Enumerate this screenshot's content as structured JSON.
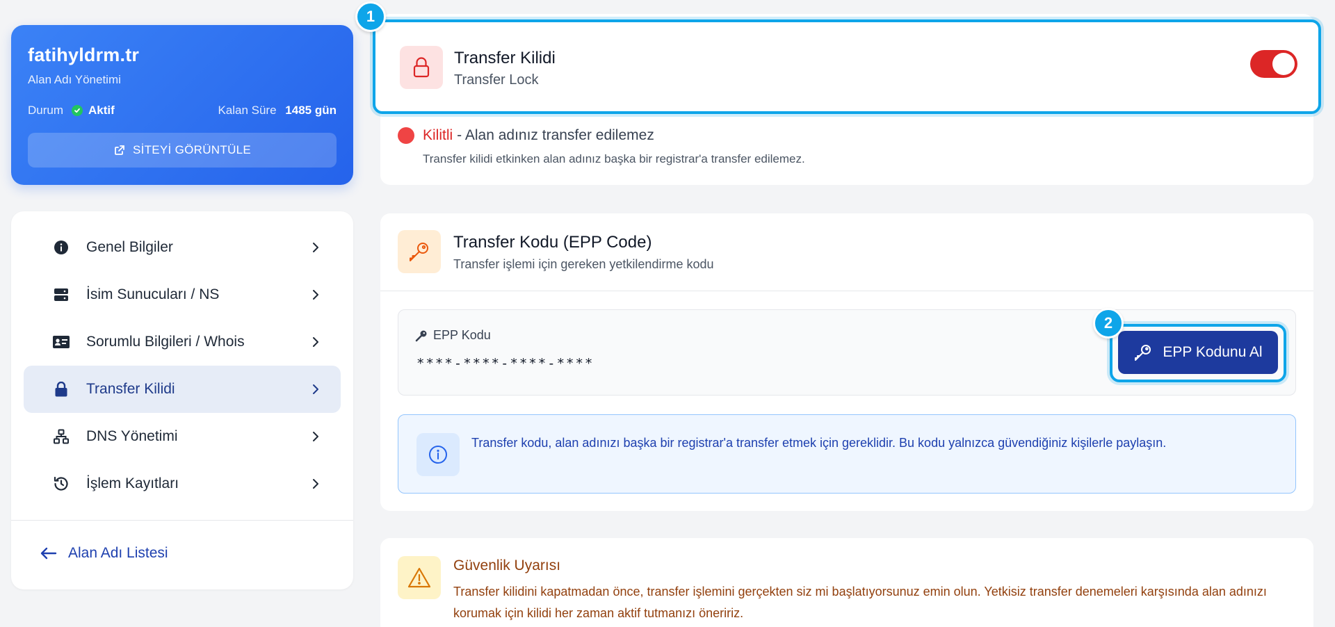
{
  "domain": {
    "name": "fatihyldrm.tr",
    "subtitle": "Alan Adı Yönetimi",
    "status_label": "Durum",
    "status_value": "Aktif",
    "remaining_label": "Kalan Süre",
    "remaining_value": "1485 gün",
    "view_button": "SİTEYİ GÖRÜNTÜLE"
  },
  "nav": {
    "items": [
      {
        "label": "Genel Bilgiler",
        "icon": "info-circle-icon"
      },
      {
        "label": "İsim Sunucuları / NS",
        "icon": "server-icon"
      },
      {
        "label": "Sorumlu Bilgileri / Whois",
        "icon": "id-card-icon"
      },
      {
        "label": "Transfer Kilidi",
        "icon": "lock-icon",
        "active": true
      },
      {
        "label": "DNS Yönetimi",
        "icon": "network-icon"
      },
      {
        "label": "İşlem Kayıtları",
        "icon": "history-icon"
      }
    ],
    "back_label": "Alan Adı Listesi"
  },
  "lock": {
    "title": "Transfer Kilidi",
    "subtitle": "Transfer Lock",
    "toggle_on": true,
    "state_word": "Kilitli",
    "state_text": "- Alan adınız transfer edilemez",
    "note": "Transfer kilidi etkinken alan adınız başka bir registrar'a transfer edilemez."
  },
  "epp": {
    "title": "Transfer Kodu (EPP Code)",
    "subtitle": "Transfer işlemi için gereken yetkilendirme kodu",
    "code_label": "EPP Kodu",
    "code_value": "****-****-****-****",
    "button": "EPP Kodunu Al",
    "info": "Transfer kodu, alan adınızı başka bir registrar'a transfer etmek için gereklidir. Bu kodu yalnızca güvendiğiniz kişilerle paylaşın."
  },
  "warning": {
    "title": "Güvenlik Uyarısı",
    "text": "Transfer kilidini kapatmadan önce, transfer işlemini gerçekten siz mi başlatıyorsunuz emin olun. Yetkisiz transfer denemeleri karşısında alan adınızı korumak için kilidi her zaman aktif tutmanızı öneririz."
  },
  "badges": [
    "1",
    "2"
  ],
  "colors": {
    "primary": "#2563eb",
    "accent_highlight": "#0ea5e9",
    "danger": "#dc2626",
    "button_dark": "#1d3a9e"
  }
}
